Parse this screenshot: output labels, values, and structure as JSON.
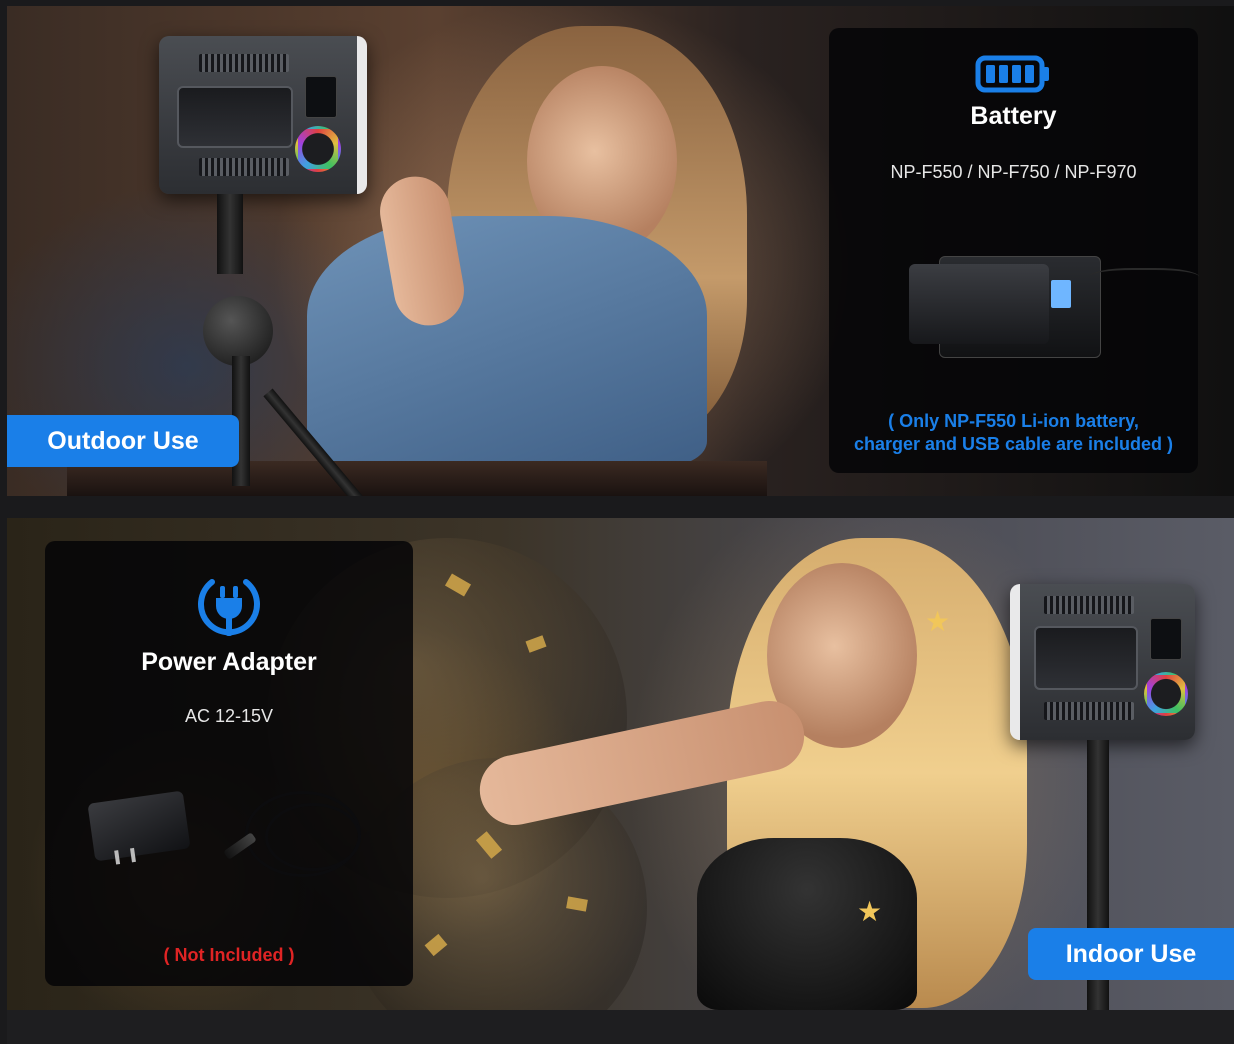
{
  "scenes": {
    "outdoor_label": "Outdoor Use",
    "indoor_label": "Indoor Use"
  },
  "battery_card": {
    "icon": "battery-icon",
    "title": "Battery",
    "spec": "NP-F550 / NP-F750 / NP-F970",
    "note_line1": "( Only NP-F550 Li-ion battery,",
    "note_line2": "charger and USB cable are included )"
  },
  "adapter_card": {
    "icon": "power-plug-icon",
    "title": "Power Adapter",
    "spec": "AC 12-15V",
    "note": "( Not Included )"
  },
  "colors": {
    "accent_blue": "#1a7fe8",
    "warning_red": "#e02424",
    "card_bg": "#050507"
  }
}
